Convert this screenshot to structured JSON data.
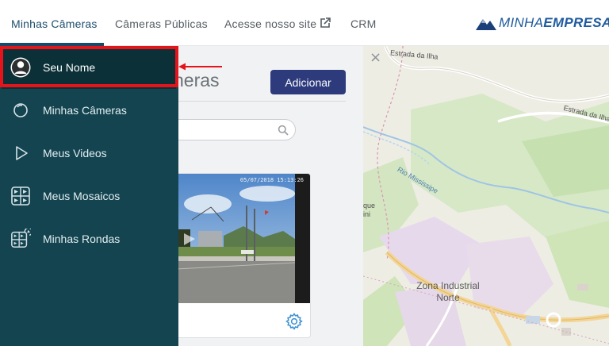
{
  "topnav": {
    "tabs": [
      {
        "label": "Minhas Câmeras",
        "active": true
      },
      {
        "label": "Câmeras Públicas",
        "active": false
      },
      {
        "label": "Acesse nosso site",
        "icon": "external-link-icon",
        "active": false
      },
      {
        "label": "CRM",
        "active": false
      }
    ],
    "logo": {
      "text_light": "MINHA",
      "text_bold": "EMPRESA"
    }
  },
  "sidebar": {
    "items": [
      {
        "label": "Seu Nome",
        "icon": "user-avatar-icon"
      },
      {
        "label": "Minhas Câmeras",
        "icon": "camera-lens-icon"
      },
      {
        "label": "Meus Videos",
        "icon": "play-icon"
      },
      {
        "label": "Meus Mosaicos",
        "icon": "mosaic-grid-icon"
      },
      {
        "label": "Minhas Rondas",
        "icon": "rounds-grid-icon"
      }
    ],
    "highlighted_item": "Seu Nome",
    "highlight_color": "#e5141b"
  },
  "main": {
    "title_visible": "neras",
    "add_button": "Adicionar",
    "search": {
      "placeholder": "",
      "icon": "search-icon"
    },
    "camera_card": {
      "timestamp": "05/07/2018 15:13:26",
      "settings_icon": "gear-icon"
    }
  },
  "map": {
    "close": "×",
    "labels": {
      "road1": "Estrada da Ilha",
      "road2": "Estrada da Ilha",
      "river": "Rio Mississipe",
      "park_a": "que",
      "park_b": "ini"
    },
    "zone": {
      "line1": "Zona Industrial",
      "line2": "Norte"
    }
  },
  "colors": {
    "sidebar_bg": "#134450",
    "accent_dark_blue": "#2d3a7c",
    "nav_active": "#164a68",
    "logo_blue": "#1f5b9e"
  }
}
